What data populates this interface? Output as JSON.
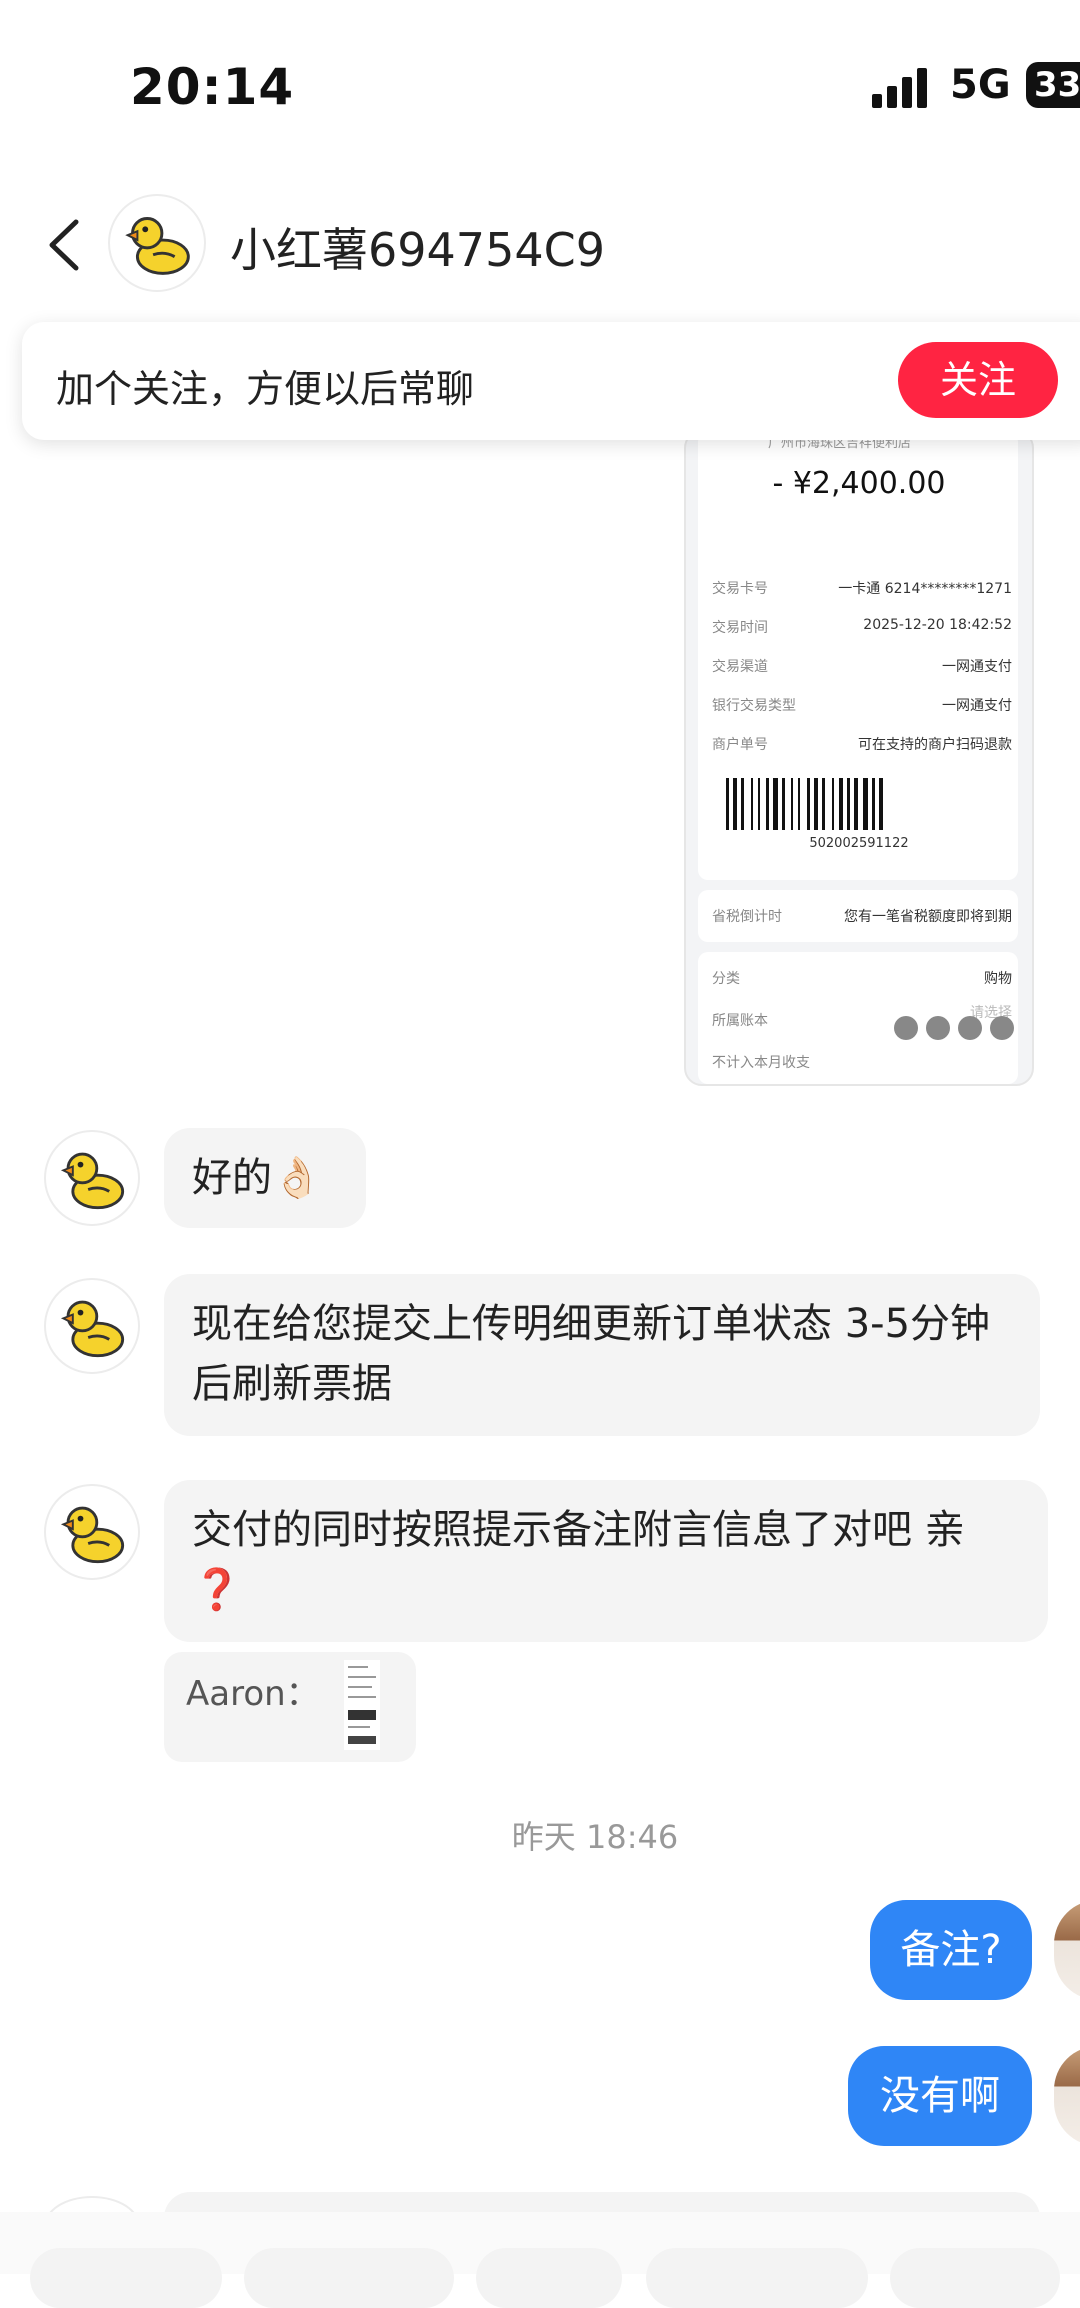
{
  "status_bar": {
    "time": "20:14",
    "network": "5G",
    "battery": "33"
  },
  "header": {
    "contact_name": "小红薯694754C9"
  },
  "follow_prompt": {
    "text": "加个关注，方便以后常聊",
    "button": "关注"
  },
  "receipt": {
    "merchant": "广州市海珠区吉祥便利店",
    "amount": "- ¥2,400.00",
    "rows": [
      {
        "label": "交易卡号",
        "value": "一卡通 6214********1271"
      },
      {
        "label": "交易时间",
        "value": "2025-12-20 18:42:52"
      },
      {
        "label": "交易渠道",
        "value": "一网通支付"
      },
      {
        "label": "银行交易类型",
        "value": "一网通支付"
      },
      {
        "label": "商户单号",
        "value": "可在支持的商户扫码退款"
      }
    ],
    "barcode_number": "502002591122",
    "tax_label": "省税倒计时",
    "tax_value": "您有一笔省税额度即将到期",
    "category_label": "分类",
    "category_value": "购物",
    "account_label": "所属账本",
    "account_value": "请选择",
    "exclude_label": "不计入本月收支"
  },
  "messages": [
    {
      "sender": "contact",
      "text": "好的",
      "emoji": "👌🏻"
    },
    {
      "sender": "contact",
      "text": "现在给您提交上传明细更新订单状态 3-5分钟后刷新票据"
    },
    {
      "sender": "contact",
      "text": "交付的同时按照提示备注附言信息了对吧 亲",
      "emoji": "❓"
    },
    {
      "sender": "contact",
      "text": "Aaron："
    }
  ],
  "timestamp": "昨天 18:46",
  "outgoing": [
    {
      "text": "备注?"
    },
    {
      "text": "没有啊"
    }
  ],
  "colors": {
    "accent_red": "#ff2442",
    "outgoing_blue": "#2f86f6",
    "bubble_gray": "#f4f4f4"
  }
}
